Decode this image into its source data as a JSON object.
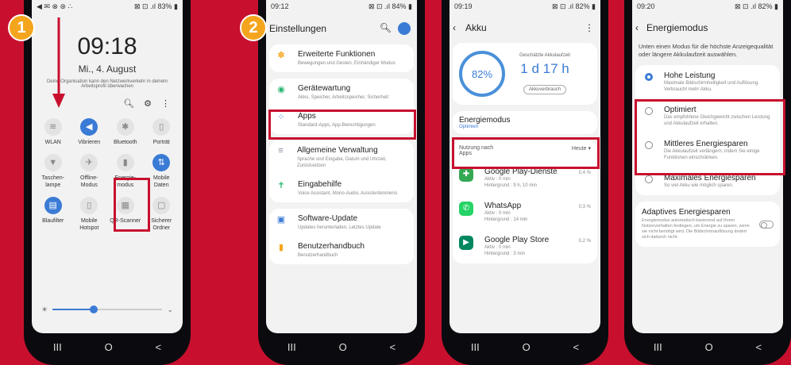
{
  "badges": [
    "1",
    "2"
  ],
  "phone1": {
    "status": "◀︎ ✉ ⊗ ⊛ ∴",
    "status_right": "⊠ ⊡ .ıl 83% ▮",
    "clock": "09:18",
    "date": "Mi., 4. August",
    "note": "Deine Organisation kann den Netzwerkverkehr in deinem Arbeitsprofil überwachen",
    "tiles": [
      {
        "label": "WLAN",
        "on": false,
        "glyph": "≋"
      },
      {
        "label": "Vibrieren",
        "on": true,
        "glyph": "◀"
      },
      {
        "label": "Bluetooth",
        "on": false,
        "glyph": "✱"
      },
      {
        "label": "Porträt",
        "on": false,
        "glyph": "▯"
      },
      {
        "label": "Taschen-\nlampe",
        "on": false,
        "glyph": "▼"
      },
      {
        "label": "Offline-\nModus",
        "on": false,
        "glyph": "✈"
      },
      {
        "label": "Energie-\nmodus",
        "on": false,
        "glyph": "▮"
      },
      {
        "label": "Mobile\nDaten",
        "on": true,
        "glyph": "⇅"
      },
      {
        "label": "Blaufilter",
        "on": true,
        "glyph": "▤"
      },
      {
        "label": "Mobile\nHotspot",
        "on": false,
        "glyph": "▯"
      },
      {
        "label": "QR-Scanner",
        "on": false,
        "glyph": "▦"
      },
      {
        "label": "Sicherer\nOrdner",
        "on": false,
        "glyph": "▢"
      }
    ]
  },
  "phone2": {
    "status_time": "09:12",
    "status_right": "⊠ ⊡ .ıl 84% ▮",
    "title": "Einstellungen",
    "rows": [
      {
        "title": "Erweiterte Funktionen",
        "sub": "Bewegungen und Gesten, Einhändiger Modus",
        "glyph": "✽",
        "color": "#f5a51d"
      },
      {
        "title": "Gerätewartung",
        "sub": "Akku, Speicher, Arbeitsspeicher, Sicherheit",
        "glyph": "◉",
        "color": "#2bb673"
      },
      {
        "title": "Apps",
        "sub": "Standard-Apps, App-Berechtigungen",
        "glyph": "⁘",
        "color": "#3a7bd5"
      },
      {
        "title": "Allgemeine Verwaltung",
        "sub": "Sprache und Eingabe, Datum und Uhrzeit, Zurücksetzen",
        "glyph": "≡",
        "color": "#8a8aa0"
      },
      {
        "title": "Eingabehilfe",
        "sub": "Voice Assistant, Mono-Audio, Assistentenmenü",
        "glyph": "✝",
        "color": "#2bb673"
      },
      {
        "title": "Software-Update",
        "sub": "Updates herunterladen, Letztes Update",
        "glyph": "▣",
        "color": "#3a7bd5"
      },
      {
        "title": "Benutzerhandbuch",
        "sub": "Benutzerhandbuch",
        "glyph": "▮",
        "color": "#f5a51d"
      }
    ]
  },
  "phone3": {
    "status_time": "09:19",
    "status_right": "⊠ ⊡ .ıl 82% ▮",
    "title": "Akku",
    "percent": "82%",
    "est_label": "Geschätzte Akkulaufzeit",
    "est_value": "1 d 17 h",
    "usage_button": "Akkuverbrauch",
    "mode_title": "Energiemodus",
    "mode_value": "Optimiert",
    "usage_label": "Nutzung nach Apps",
    "period": "Heute",
    "apps": [
      {
        "name": "Google Play-Dienste",
        "active": "Aktiv : 0 min",
        "bg": "Hintergrund : 9 h, 10 min",
        "pct": "0,4 %",
        "color": "#34a853",
        "glyph": "✚"
      },
      {
        "name": "WhatsApp",
        "active": "Aktiv : 0 min",
        "bg": "Hintergrund : 14 min",
        "pct": "0,3 %",
        "color": "#25d366",
        "glyph": "✆"
      },
      {
        "name": "Google Play Store",
        "active": "Aktiv : 0 min",
        "bg": "Hintergrund : 3 min",
        "pct": "0,2 %",
        "color": "#01875f",
        "glyph": "▶"
      }
    ]
  },
  "phone4": {
    "status_time": "09:20",
    "status_right": "⊠ ⊡ .ıl 82% ▮",
    "title": "Energiemodus",
    "intro": "Unten einen Modus für die höchste Anzeigequalität oder längere Akkulaufzeit auswählen.",
    "options": [
      {
        "title": "Hohe Leistung",
        "sub": "Maximale Bildschirmhelligkeit und Auflösung. Verbraucht mehr Akku.",
        "selected": true
      },
      {
        "title": "Optimiert",
        "sub": "Das empfohlene Gleichgewicht zwischen Leistung und Akkulaufzeit erhalten.",
        "selected": false
      },
      {
        "title": "Mittleres Energiesparen",
        "sub": "Die Akkulaufzeit verlängern, indem Sie einige Funktionen einschränken.",
        "selected": false
      },
      {
        "title": "Maximales Energiesparen",
        "sub": "So viel Akku wie möglich sparen.",
        "selected": false
      }
    ],
    "adaptive_title": "Adaptives Energiesparen",
    "adaptive_sub": "Energiemodus automatisch basierend auf Ihrem Nutzerverhalten festlegen, um Energie zu sparen, wenn sie nicht benötigt wird. Die Bildschirmauflösung ändert sich dadurch nicht."
  },
  "nav": {
    "recents": "III",
    "home": "O",
    "back": "<"
  },
  "colors": {
    "accent": "#3a7bd5",
    "highlight": "#c8102e",
    "badge": "#f5a51d"
  }
}
